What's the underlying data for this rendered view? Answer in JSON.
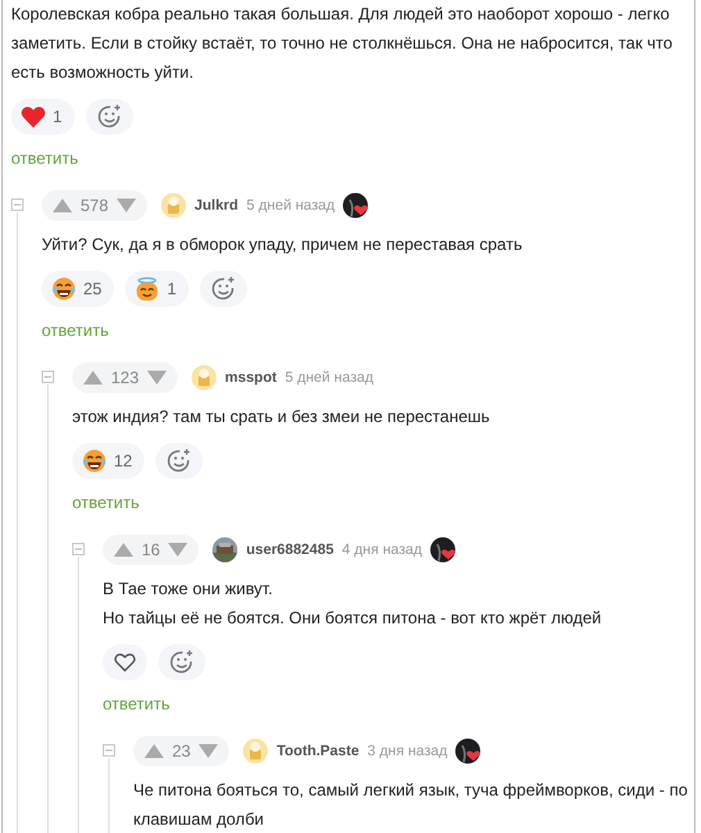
{
  "comment": {
    "paragraphs": [
      "Королевская кобра реально такая большая. Для людей это наоборот хорошо - легко заметить. Если в стойку встаёт, то точно не столкнёшься. Она не набросится, так что есть возможность уйти."
    ],
    "reactions": [
      {
        "kind": "heart",
        "selected": true,
        "count": "1"
      },
      {
        "kind": "add"
      }
    ],
    "reply_label": "ответить",
    "replies": [
      {
        "rating": "578",
        "custom_avatar": false,
        "author": "Julkrd",
        "time": "5 дней назад",
        "award": true,
        "paragraphs": [
          "Уйти? Сук, да я в обморок упаду, причем не переставая срать"
        ],
        "reactions": [
          {
            "kind": "laugh",
            "count": "25"
          },
          {
            "kind": "halo",
            "count": "1"
          },
          {
            "kind": "add"
          }
        ],
        "reply_label": "ответить",
        "replies": [
          {
            "rating": "123",
            "custom_avatar": false,
            "author": "msspot",
            "time": "5 дней назад",
            "paragraphs": [
              "этож индия? там ты срать и без змеи не перестанешь"
            ],
            "reactions": [
              {
                "kind": "laugh",
                "count": "12"
              },
              {
                "kind": "add"
              }
            ],
            "reply_label": "ответить",
            "replies": [
              {
                "rating": "16",
                "custom_avatar": true,
                "author": "user6882485",
                "time": "4 дня назад",
                "award": true,
                "paragraphs": [
                  "В Тае тоже они живут.",
                  "Но тайцы её не боятся. Они боятся питона - вот кто жрёт людей"
                ],
                "reactions": [
                  {
                    "kind": "heart",
                    "selected": false
                  },
                  {
                    "kind": "add"
                  }
                ],
                "reply_label": "ответить",
                "replies": [
                  {
                    "rating": "23",
                    "custom_avatar": false,
                    "author": "Tooth.Paste",
                    "time": "3 дня назад",
                    "award": true,
                    "paragraphs": [
                      "Че питона бояться то, самый легкий язык, туча фреймворков, сиди - по клавишам долби"
                    ]
                  }
                ]
              }
            ]
          }
        ]
      }
    ]
  }
}
